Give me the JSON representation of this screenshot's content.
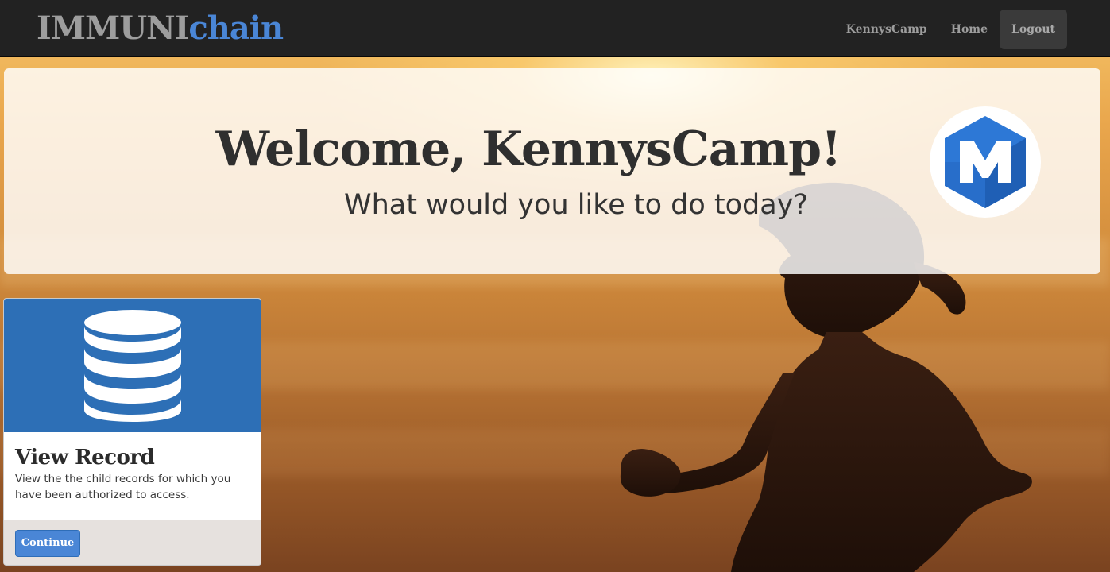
{
  "navbar": {
    "brand_part1": "IMMUNI",
    "brand_part2": "chain",
    "links": [
      {
        "label": "KennysCamp"
      },
      {
        "label": "Home"
      },
      {
        "label": "Logout"
      }
    ]
  },
  "jumbotron": {
    "title": "Welcome, KennysCamp!",
    "subtitle": "What would you like to do today?",
    "logo_icon": "hexagon-m-logo-icon"
  },
  "card": {
    "icon": "database-icon",
    "title": "View Record",
    "text": "View the the child records for which you have been authorized to access.",
    "button_label": "Continue"
  },
  "colors": {
    "navbar_bg": "#222222",
    "brand_gray": "#9d9d9d",
    "brand_blue": "#4a86d6",
    "card_header_blue": "#2d6fb6",
    "button_blue": "#4a86d6"
  }
}
